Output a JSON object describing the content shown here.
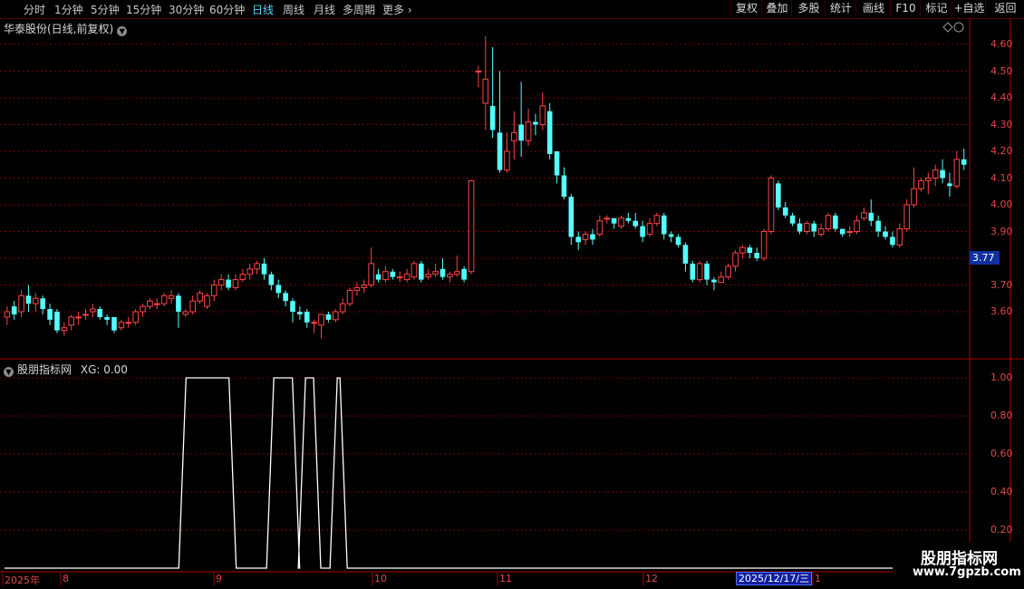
{
  "toolbar": {
    "period_tabs": [
      "分时",
      "1分钟",
      "5分钟",
      "15分钟",
      "30分钟",
      "60分钟",
      "日线",
      "周线",
      "月线",
      "多周期",
      "更多"
    ],
    "active_tab": "日线",
    "right_buttons": [
      "复权",
      "叠加",
      "多股",
      "统计",
      "画线",
      "F10",
      "标记",
      "+自选",
      "返回"
    ]
  },
  "chart": {
    "title": "华泰股份(日线,前复权)",
    "price_labels": [
      "4.60",
      "4.50",
      "4.40",
      "4.30",
      "4.20",
      "4.10",
      "4.00",
      "3.90",
      "3.70",
      "3.60"
    ],
    "current_price_badge": "3.77"
  },
  "indicator": {
    "title": "股朋指标网",
    "value_text": "XG: 0.00",
    "labels": [
      "1.00",
      "0.80",
      "0.60",
      "0.40",
      "0.20"
    ]
  },
  "date_axis": {
    "labels": [
      "2025年",
      "8",
      "9",
      "10",
      "11",
      "12",
      "1"
    ],
    "cursor_date": "2025/12/17/三"
  },
  "watermark": {
    "line1": "股朋指标网",
    "line2": "www.7gpzb.com"
  },
  "colors": {
    "up": "#ff4444",
    "down": "#54ffff",
    "grid": "#7a0000",
    "indicator": "#ffffff",
    "active_tab": "#5ad8ff"
  },
  "candles": [
    [
      3.58,
      3.6,
      3.55,
      3.62
    ],
    [
      3.62,
      3.59,
      3.57,
      3.64
    ],
    [
      3.6,
      3.66,
      3.58,
      3.68
    ],
    [
      3.66,
      3.63,
      3.6,
      3.7
    ],
    [
      3.63,
      3.65,
      3.6,
      3.67
    ],
    [
      3.65,
      3.61,
      3.59,
      3.66
    ],
    [
      3.61,
      3.57,
      3.55,
      3.63
    ],
    [
      3.6,
      3.53,
      3.52,
      3.61
    ],
    [
      3.53,
      3.54,
      3.51,
      3.56
    ],
    [
      3.55,
      3.58,
      3.53,
      3.59
    ],
    [
      3.58,
      3.58,
      3.55,
      3.6
    ],
    [
      3.59,
      3.59,
      3.57,
      3.61
    ],
    [
      3.6,
      3.61,
      3.58,
      3.63
    ],
    [
      3.61,
      3.58,
      3.57,
      3.62
    ],
    [
      3.58,
      3.57,
      3.55,
      3.59
    ],
    [
      3.58,
      3.53,
      3.52,
      3.58
    ],
    [
      3.54,
      3.56,
      3.53,
      3.57
    ],
    [
      3.56,
      3.56,
      3.54,
      3.58
    ],
    [
      3.56,
      3.6,
      3.55,
      3.61
    ],
    [
      3.6,
      3.62,
      3.58,
      3.63
    ],
    [
      3.62,
      3.64,
      3.61,
      3.65
    ],
    [
      3.63,
      3.63,
      3.61,
      3.65
    ],
    [
      3.63,
      3.66,
      3.62,
      3.67
    ],
    [
      3.65,
      3.66,
      3.63,
      3.68
    ],
    [
      3.66,
      3.6,
      3.54,
      3.67
    ],
    [
      3.59,
      3.6,
      3.58,
      3.61
    ],
    [
      3.6,
      3.64,
      3.59,
      3.66
    ],
    [
      3.64,
      3.67,
      3.63,
      3.68
    ],
    [
      3.62,
      3.66,
      3.61,
      3.67
    ],
    [
      3.66,
      3.7,
      3.64,
      3.72
    ],
    [
      3.7,
      3.72,
      3.68,
      3.74
    ],
    [
      3.72,
      3.69,
      3.68,
      3.74
    ],
    [
      3.69,
      3.72,
      3.68,
      3.74
    ],
    [
      3.72,
      3.74,
      3.71,
      3.76
    ],
    [
      3.74,
      3.76,
      3.72,
      3.78
    ],
    [
      3.76,
      3.78,
      3.74,
      3.79
    ],
    [
      3.78,
      3.74,
      3.72,
      3.8
    ],
    [
      3.74,
      3.7,
      3.68,
      3.75
    ],
    [
      3.7,
      3.67,
      3.65,
      3.72
    ],
    [
      3.67,
      3.64,
      3.62,
      3.68
    ],
    [
      3.64,
      3.6,
      3.56,
      3.65
    ],
    [
      3.6,
      3.59,
      3.57,
      3.62
    ],
    [
      3.6,
      3.56,
      3.54,
      3.61
    ],
    [
      3.56,
      3.56,
      3.52,
      3.57
    ],
    [
      3.55,
      3.59,
      3.5,
      3.59
    ],
    [
      3.59,
      3.57,
      3.56,
      3.6
    ],
    [
      3.57,
      3.6,
      3.56,
      3.61
    ],
    [
      3.6,
      3.63,
      3.59,
      3.65
    ],
    [
      3.63,
      3.68,
      3.62,
      3.69
    ],
    [
      3.68,
      3.69,
      3.66,
      3.71
    ],
    [
      3.69,
      3.7,
      3.67,
      3.72
    ],
    [
      3.7,
      3.78,
      3.69,
      3.84
    ],
    [
      3.74,
      3.72,
      3.71,
      3.76
    ],
    [
      3.72,
      3.75,
      3.71,
      3.77
    ],
    [
      3.75,
      3.73,
      3.72,
      3.76
    ],
    [
      3.73,
      3.73,
      3.71,
      3.75
    ],
    [
      3.72,
      3.74,
      3.71,
      3.76
    ],
    [
      3.73,
      3.78,
      3.72,
      3.79
    ],
    [
      3.78,
      3.72,
      3.71,
      3.79
    ],
    [
      3.73,
      3.74,
      3.72,
      3.76
    ],
    [
      3.74,
      3.75,
      3.73,
      3.78
    ],
    [
      3.76,
      3.73,
      3.72,
      3.8
    ],
    [
      3.73,
      3.74,
      3.71,
      3.75
    ],
    [
      3.74,
      3.75,
      3.73,
      3.81
    ],
    [
      3.76,
      3.72,
      3.71,
      3.77
    ],
    [
      3.75,
      4.09,
      3.74,
      4.09
    ],
    [
      4.5,
      4.5,
      4.44,
      4.52
    ],
    [
      4.38,
      4.47,
      4.28,
      4.63
    ],
    [
      4.37,
      4.28,
      4.25,
      4.59
    ],
    [
      4.27,
      4.13,
      4.12,
      4.5
    ],
    [
      4.13,
      4.2,
      4.12,
      4.27
    ],
    [
      4.24,
      4.27,
      4.17,
      4.35
    ],
    [
      4.3,
      4.24,
      4.18,
      4.46
    ],
    [
      4.24,
      4.31,
      4.22,
      4.36
    ],
    [
      4.31,
      4.3,
      4.26,
      4.34
    ],
    [
      4.3,
      4.37,
      4.28,
      4.42
    ],
    [
      4.35,
      4.19,
      4.17,
      4.38
    ],
    [
      4.2,
      4.11,
      4.08,
      4.2
    ],
    [
      4.11,
      4.03,
      4.02,
      4.14
    ],
    [
      4.03,
      3.88,
      3.85,
      4.04
    ],
    [
      3.88,
      3.86,
      3.83,
      3.9
    ],
    [
      3.87,
      3.89,
      3.85,
      3.9
    ],
    [
      3.89,
      3.87,
      3.85,
      3.91
    ],
    [
      3.89,
      3.94,
      3.88,
      3.96
    ],
    [
      3.95,
      3.95,
      3.93,
      3.96
    ],
    [
      3.95,
      3.93,
      3.91,
      3.95
    ],
    [
      3.92,
      3.95,
      3.91,
      3.96
    ],
    [
      3.95,
      3.94,
      3.93,
      3.97
    ],
    [
      3.94,
      3.92,
      3.91,
      3.97
    ],
    [
      3.92,
      3.88,
      3.86,
      3.94
    ],
    [
      3.89,
      3.93,
      3.88,
      3.95
    ],
    [
      3.93,
      3.96,
      3.92,
      3.97
    ],
    [
      3.96,
      3.89,
      3.87,
      3.97
    ],
    [
      3.89,
      3.88,
      3.86,
      3.9
    ],
    [
      3.88,
      3.85,
      3.84,
      3.89
    ],
    [
      3.85,
      3.78,
      3.75,
      3.86
    ],
    [
      3.78,
      3.72,
      3.71,
      3.79
    ],
    [
      3.72,
      3.78,
      3.71,
      3.79
    ],
    [
      3.78,
      3.72,
      3.7,
      3.79
    ],
    [
      3.72,
      3.71,
      3.68,
      3.73
    ],
    [
      3.71,
      3.73,
      3.71,
      3.75
    ],
    [
      3.73,
      3.77,
      3.72,
      3.78
    ],
    [
      3.77,
      3.82,
      3.75,
      3.83
    ],
    [
      3.82,
      3.84,
      3.8,
      3.85
    ],
    [
      3.84,
      3.82,
      3.8,
      3.85
    ],
    [
      3.82,
      3.8,
      3.79,
      3.84
    ],
    [
      3.8,
      3.9,
      3.79,
      3.91
    ],
    [
      3.9,
      4.1,
      3.89,
      4.11
    ],
    [
      4.08,
      3.99,
      3.98,
      4.09
    ],
    [
      3.99,
      3.96,
      3.95,
      4.01
    ],
    [
      3.96,
      3.93,
      3.92,
      3.97
    ],
    [
      3.93,
      3.9,
      3.89,
      3.95
    ],
    [
      3.9,
      3.93,
      3.89,
      3.94
    ],
    [
      3.93,
      3.9,
      3.88,
      3.94
    ],
    [
      3.89,
      3.91,
      3.88,
      3.93
    ],
    [
      3.91,
      3.96,
      3.9,
      3.97
    ],
    [
      3.96,
      3.91,
      3.9,
      3.97
    ],
    [
      3.91,
      3.89,
      3.88,
      3.91
    ],
    [
      3.9,
      3.9,
      3.88,
      3.92
    ],
    [
      3.9,
      3.94,
      3.89,
      3.96
    ],
    [
      3.95,
      3.97,
      3.94,
      3.99
    ],
    [
      3.97,
      3.94,
      3.92,
      4.02
    ],
    [
      3.94,
      3.9,
      3.88,
      3.96
    ],
    [
      3.9,
      3.88,
      3.87,
      3.92
    ],
    [
      3.88,
      3.85,
      3.84,
      3.9
    ],
    [
      3.85,
      3.91,
      3.84,
      3.93
    ],
    [
      3.91,
      4.0,
      3.9,
      4.02
    ],
    [
      4.0,
      4.06,
      3.99,
      4.14
    ],
    [
      4.06,
      4.09,
      4.05,
      4.1
    ],
    [
      4.09,
      4.1,
      4.04,
      4.12
    ],
    [
      4.1,
      4.13,
      4.07,
      4.15
    ],
    [
      4.13,
      4.1,
      4.08,
      4.17
    ],
    [
      4.08,
      4.07,
      4.03,
      4.12
    ],
    [
      4.07,
      4.17,
      4.06,
      4.2
    ],
    [
      4.17,
      4.15,
      4.13,
      4.21
    ]
  ],
  "xg_signal": [
    {
      "start": "2025-08-26",
      "end": "2025-09-03",
      "value": 1
    },
    {
      "start": "2025-09-12",
      "end": "2025-09-15",
      "value": 1
    },
    {
      "start": "2025-09-18",
      "end": "2025-09-19",
      "value": 1
    },
    {
      "start": "2025-09-24",
      "end": "2025-09-24",
      "value": 1
    }
  ]
}
